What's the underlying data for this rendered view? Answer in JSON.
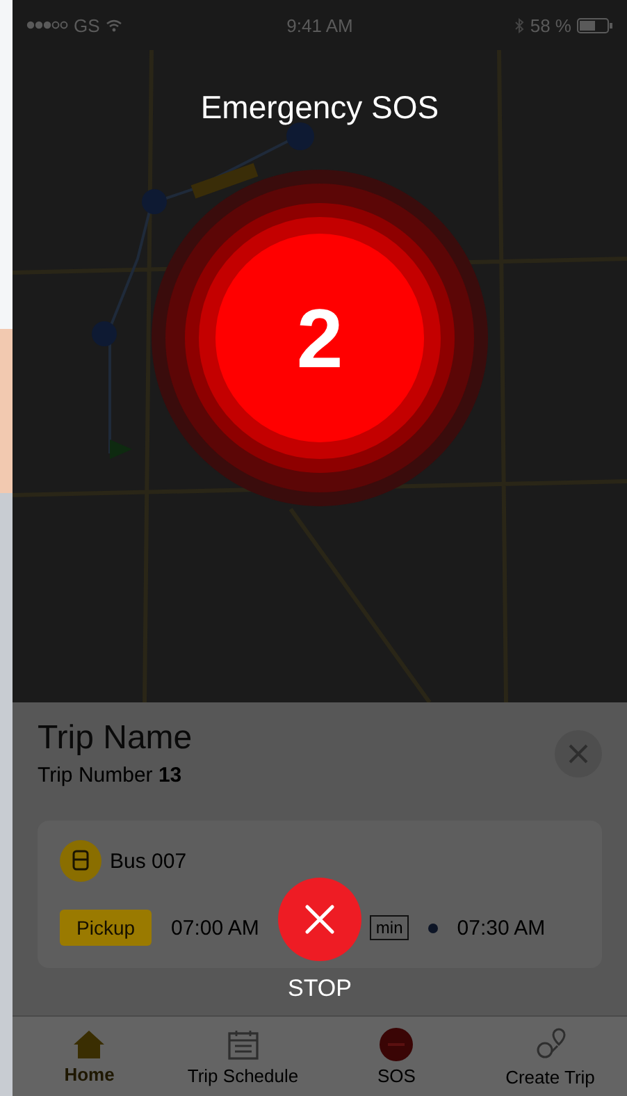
{
  "status_bar": {
    "carrier": "GS",
    "time": "9:41 AM",
    "battery": "58 %"
  },
  "sos": {
    "title": "Emergency SOS",
    "countdown": "2",
    "stop_label": "STOP"
  },
  "trip": {
    "name": "Trip Name",
    "number": "Trip Number **13**"
  },
  "vehicle": {
    "name": "Bus 007"
  },
  "stop": {
    "type": "Pickup",
    "start": "07:00 AM",
    "duration": "min",
    "end": "07:30 AM"
  },
  "tabs": [
    {
      "label": "Home",
      "kind": "home",
      "selected": true
    },
    {
      "label": "Trip Schedule",
      "kind": "calendar",
      "selected": false
    },
    {
      "label": "SOS",
      "kind": "sos",
      "selected": false
    },
    {
      "label": "Create Trip",
      "kind": "route",
      "selected": false
    }
  ]
}
